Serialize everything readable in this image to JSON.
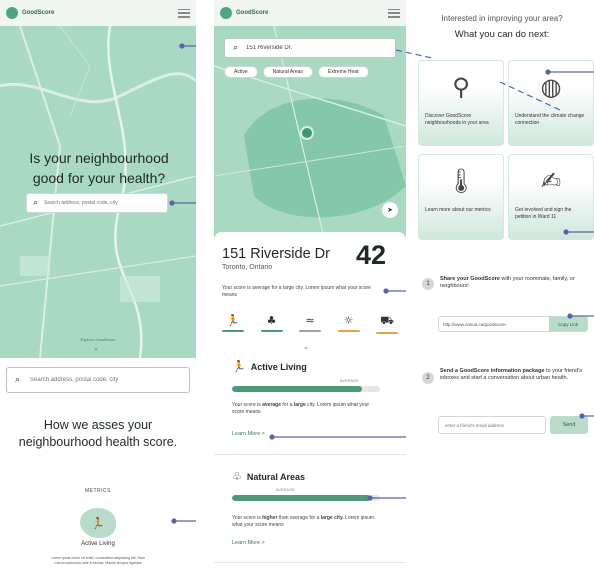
{
  "brand": {
    "name": "GoodScore",
    "name_alt": "GoodScore"
  },
  "panel1": {
    "hero_title": "Is your neighbourhood good for your health?",
    "search_placeholder": "Search address, postal code, city",
    "explore_label": "Explore GoodScore",
    "search2_placeholder": "Search address, postal code, city",
    "assess_title": "How we asses your neighbourhood health score.",
    "metrics_label": "METRICS",
    "metric_name": "Active Living",
    "metric_desc": "Lorem ipsum dolor sit amet, consectetur adipiscing elit. Nam rutrum commodo ante in lacinia. Mauris tempus egestas"
  },
  "panel2": {
    "search_value": "151 Riverside Dr.",
    "chips": [
      "Active",
      "Natural Areas",
      "Extreme Heat"
    ],
    "address": "151 Riverside Dr",
    "city": "Toronto, Ontario",
    "score": "42",
    "score_desc": "Your score is average for a large city. Lorem ipsum what your score means",
    "metric_icons": [
      "runner-icon",
      "tree-icon",
      "wind-icon",
      "sun-icon",
      "bus-icon"
    ],
    "metric_colors": [
      "#4e9a77",
      "#4e9a77",
      "#9aa7a1",
      "#e6a24a",
      "#e6a24a"
    ],
    "sections": [
      {
        "title": "Active Living",
        "avg_label": "AVERAGE",
        "fill": 0.88,
        "desc_pre": "Your score is ",
        "desc_bold1": "average",
        "desc_mid": " for a ",
        "desc_bold2": "large",
        "desc_post": " city. Lorem ipsum what your score means",
        "learn": "Learn More >"
      },
      {
        "title": "Natural Areas",
        "avg_label": "AVERAGE",
        "fill": 0.93,
        "desc_pre": "Your score is ",
        "desc_bold1": "higher",
        "desc_mid": " than average for a ",
        "desc_bold2": "large city.",
        "desc_post": " Lorem ipsum what your score means",
        "learn": "Learn More >"
      }
    ]
  },
  "panel3": {
    "interested": "Interested in improving your area?",
    "next": "What you can do next:",
    "tiles": [
      {
        "icon": "magnifier-icon",
        "text": "Discover GoodScore neighbourhoods in your area"
      },
      {
        "icon": "globe-icon",
        "text": "Understand the climate change connection"
      },
      {
        "icon": "thermometer-icon",
        "text": "Learn more about our metrics"
      },
      {
        "icon": "petition-icon",
        "text": "Get involved and sign the petition in Ward 11"
      }
    ],
    "step1_num": "1",
    "step1_bold": "Share your GoodScore",
    "step1_text": " with your roommate, family, or neighbours!",
    "link_value": "http://www.canua.ca/goodscore-",
    "copy_label": "Copy Link",
    "step2_num": "2",
    "step2_bold": "Send a GoodScore information package",
    "step2_text": " to your friend's inboxes and start a conversation about urban health.",
    "email_placeholder": "enter a friend's email address",
    "send_label": "Send"
  },
  "colors": {
    "accent": "#4e9a77",
    "map": "#a9d8c3",
    "annotation": "#5a63a8"
  }
}
